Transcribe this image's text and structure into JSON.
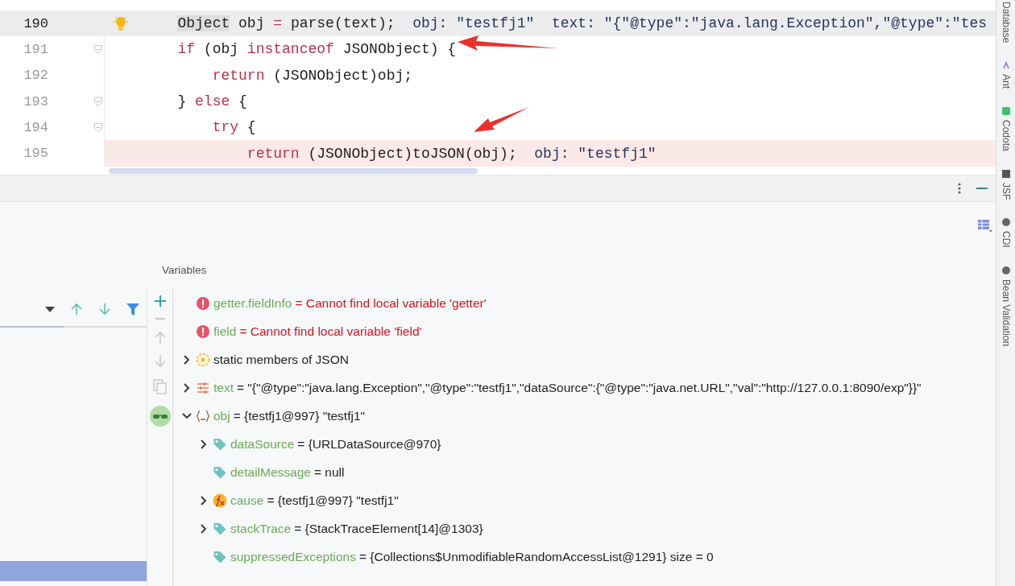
{
  "editor": {
    "lines": [
      {
        "number": "190",
        "current": true,
        "breakpoint": false,
        "bulb": true,
        "fold": false,
        "tokens": [
          {
            "t": "        Object",
            "kind": "mark"
          },
          {
            "t": " obj ",
            "kind": "plain"
          },
          {
            "t": "=",
            "kind": "kw"
          },
          {
            "t": " parse(text);  ",
            "kind": "plain"
          },
          {
            "t": "obj: \"testfj1\"  text: \"{\"@type\":\"java.lang.Exception\",\"@type\":\"tes",
            "kind": "val"
          }
        ]
      },
      {
        "number": "191",
        "current": false,
        "breakpoint": false,
        "bulb": false,
        "fold": true,
        "tokens": [
          {
            "t": "        if",
            "kind": "kw"
          },
          {
            "t": " (obj ",
            "kind": "plain"
          },
          {
            "t": "instanceof",
            "kind": "kw"
          },
          {
            "t": " JSONObject) {",
            "kind": "plain"
          }
        ]
      },
      {
        "number": "192",
        "current": false,
        "breakpoint": false,
        "bulb": false,
        "fold": false,
        "tokens": [
          {
            "t": "            return",
            "kind": "kw"
          },
          {
            "t": " (JSONObject)obj;",
            "kind": "plain"
          }
        ]
      },
      {
        "number": "193",
        "current": false,
        "breakpoint": false,
        "bulb": false,
        "fold": true,
        "tokens": [
          {
            "t": "        } ",
            "kind": "plain"
          },
          {
            "t": "else",
            "kind": "kw"
          },
          {
            "t": " {",
            "kind": "plain"
          }
        ]
      },
      {
        "number": "194",
        "current": false,
        "breakpoint": false,
        "bulb": false,
        "fold": true,
        "tokens": [
          {
            "t": "            try",
            "kind": "kw"
          },
          {
            "t": " {",
            "kind": "plain"
          }
        ]
      },
      {
        "number": "195",
        "current": false,
        "breakpoint": true,
        "bulb": false,
        "fold": false,
        "tokens": [
          {
            "t": "                return",
            "kind": "kw"
          },
          {
            "t": " (JSONObject)toJSON(obj);  ",
            "kind": "plain"
          },
          {
            "t": "obj: \"testfj1\"",
            "kind": "val"
          }
        ]
      }
    ],
    "annotations": [
      {
        "kind": "arrow"
      },
      {
        "kind": "arrow"
      }
    ]
  },
  "debugger": {
    "section_title": "Variables",
    "frames": [
      {
        "selected": true
      }
    ],
    "variables": [
      {
        "kind": "error",
        "name": "getter.fieldInfo",
        "value": "= Cannot find local variable 'getter'"
      },
      {
        "kind": "error",
        "name": "field",
        "value": "= Cannot find local variable 'field'"
      },
      {
        "kind": "static",
        "label": "static members of JSON",
        "expanded": false
      },
      {
        "kind": "string",
        "name": "text",
        "value": "= \"{\"@type\":\"java.lang.Exception\",\"@type\":\"testfj1\",\"dataSource\":{\"@type\":\"java.net.URL\",\"val\":\"http://127.0.0.1:8090/exp\"}}\"",
        "expanded": false
      },
      {
        "kind": "object",
        "name": "obj",
        "value": "= {testfj1@997} \"testfj1\"",
        "expanded": true,
        "children": [
          {
            "kind": "field",
            "name": "dataSource",
            "value": "= {URLDataSource@970}",
            "expanded": false
          },
          {
            "kind": "field",
            "name": "detailMessage",
            "value": "= null"
          },
          {
            "kind": "method",
            "name": "cause",
            "value": "= {testfj1@997} \"testfj1\"",
            "expanded": false
          },
          {
            "kind": "field",
            "name": "stackTrace",
            "value": "= {StackTraceElement[14]@1303}",
            "expanded": false
          },
          {
            "kind": "field",
            "name": "suppressedExceptions",
            "value": "= {Collections$UnmodifiableRandomAccessList@1291}  size = 0"
          }
        ]
      }
    ]
  },
  "tool_windows": [
    {
      "kind": "database",
      "label": "Database"
    },
    {
      "kind": "ant",
      "label": "Ant"
    },
    {
      "kind": "codota",
      "label": "Codota"
    },
    {
      "kind": "jsf",
      "label": "JSF"
    },
    {
      "kind": "cdi",
      "label": "CDI"
    },
    {
      "kind": "bean",
      "label": "Bean Validation"
    }
  ]
}
